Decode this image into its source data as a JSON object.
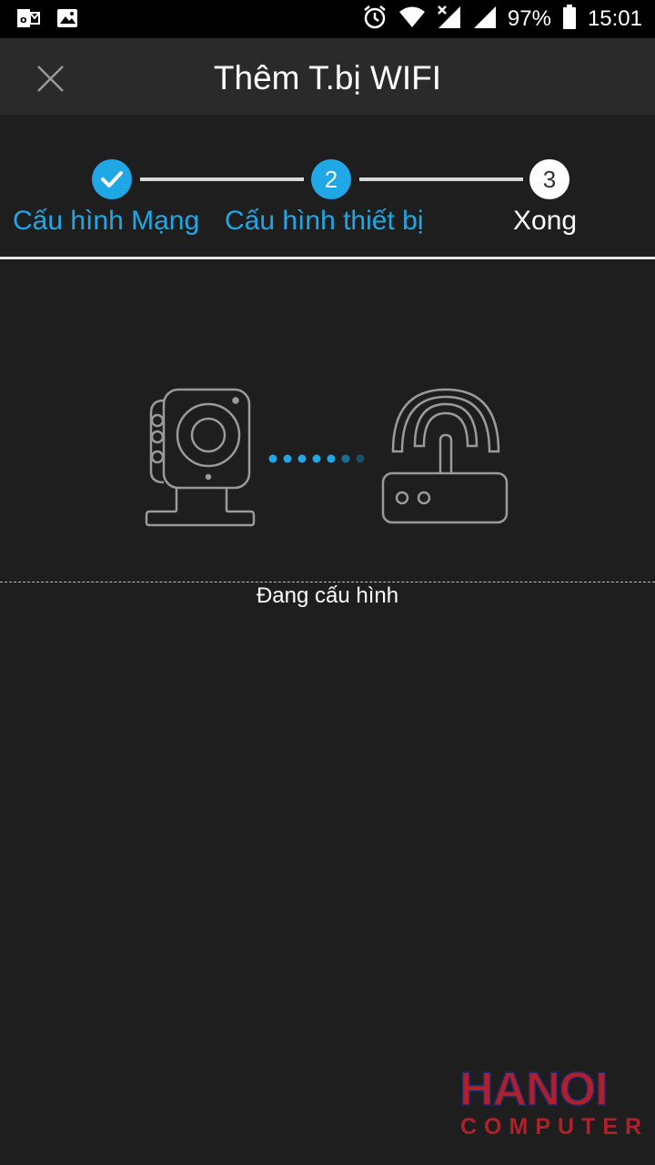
{
  "status_bar": {
    "battery": "97%",
    "time": "15:01",
    "icons": [
      "outlook-icon",
      "image-icon",
      "alarm-icon",
      "wifi-icon",
      "signal-no-data-icon",
      "signal-icon",
      "battery-icon"
    ]
  },
  "app_bar": {
    "title": "Thêm T.bị WIFI",
    "close_icon": "close-icon"
  },
  "stepper": {
    "steps": [
      {
        "label": "Cấu hình Mạng",
        "state": "done",
        "marker": ""
      },
      {
        "label": "Cấu hình thiết bị",
        "state": "active",
        "marker": "2"
      },
      {
        "label": "Xong",
        "state": "todo",
        "marker": "3"
      }
    ]
  },
  "illustration": {
    "left_icon": "camera-icon",
    "right_icon": "router-icon",
    "dots_icon": "progress-dots-icon"
  },
  "status_text": "Đang cấu hình",
  "watermark": {
    "line1": "HANOI",
    "line2": "COMPUTER"
  },
  "colors": {
    "accent": "#1fa7e6",
    "background": "#1e1e1e",
    "appbar": "#2a2a2a",
    "watermark_red": "#b0202a",
    "watermark_navy": "#1f2a6b"
  }
}
